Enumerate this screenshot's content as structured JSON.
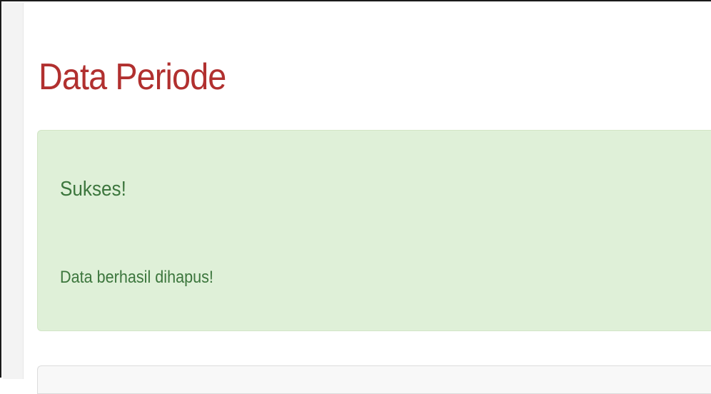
{
  "page": {
    "title": "Data Periode"
  },
  "alert": {
    "heading": "Sukses!",
    "message": "Data berhasil dihapus!"
  },
  "colors": {
    "title": "#b1302f",
    "alert_background": "#dff0d8",
    "alert_text": "#3c763d"
  }
}
